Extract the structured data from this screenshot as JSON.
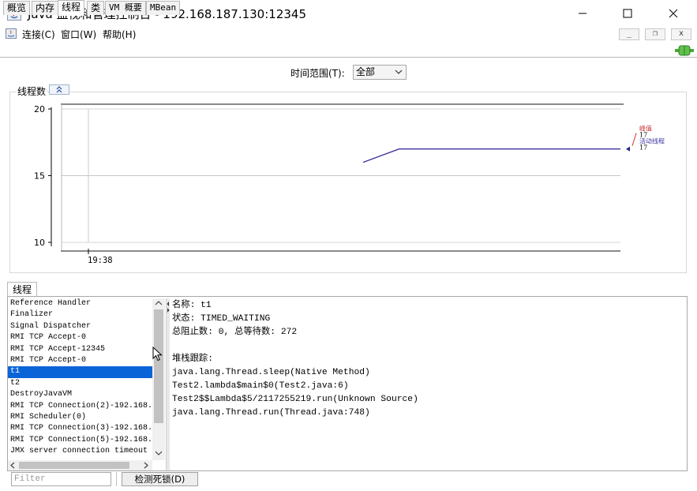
{
  "window": {
    "title": "Java 监视和管理控制台 - 192.168.187.130:12345",
    "minimize_glyph": "—",
    "maximize_glyph": "☐",
    "close_glyph": "✕"
  },
  "menu": {
    "items": [
      "连接(C)",
      "窗口(W)",
      "帮助(H)"
    ],
    "mdi_minimize": "_",
    "mdi_restore": "❐",
    "mdi_close": "x"
  },
  "tabs": [
    "概览",
    "内存",
    "线程",
    "类",
    "VM 概要",
    "MBean"
  ],
  "active_tab": "线程",
  "time_range": {
    "label": "时间范围(T):",
    "selected": "全部"
  },
  "chart_data": {
    "type": "line",
    "title": "线程数",
    "ylim": [
      10,
      20
    ],
    "yticks": [
      "20",
      "15",
      "10"
    ],
    "xticks": [
      "19:38"
    ],
    "series": [
      {
        "name": "峰值",
        "color": "#cc3333",
        "last_value": "17"
      },
      {
        "name": "活动线程",
        "color": "#3d35a0",
        "last_value": "17",
        "points": [
          [
            0.0,
            16.0
          ],
          [
            0.14,
            17.0
          ],
          [
            1.0,
            17.0
          ]
        ]
      }
    ]
  },
  "threads": {
    "tab_label": "线程",
    "items": [
      "Reference Handler",
      "Finalizer",
      "Signal Dispatcher",
      "RMI TCP Accept-0",
      "RMI TCP Accept-12345",
      "RMI TCP Accept-0",
      "t1",
      "t2",
      "DestroyJavaVM",
      "RMI TCP Connection(2)-192.168.",
      "RMI Scheduler(0)",
      "RMI TCP Connection(3)-192.168.",
      "RMI TCP Connection(5)-192.168.",
      "JMX server connection timeout"
    ],
    "selected_index": 6,
    "detail": [
      "名称: t1",
      "状态: TIMED_WAITING",
      "总阻止数: 0, 总等待数: 272",
      "",
      "堆栈跟踪:",
      "java.lang.Thread.sleep(Native Method)",
      "Test2.lambda$main$0(Test2.java:6)",
      "Test2$$Lambda$5/2117255219.run(Unknown Source)",
      "java.lang.Thread.run(Thread.java:748)"
    ]
  },
  "filter": {
    "placeholder": "Filter"
  },
  "detect_deadlock_label": "检测死锁(D)",
  "colors": {
    "selection": "#0a64d8",
    "peak": "#cc3333",
    "live": "#3d35a0"
  }
}
